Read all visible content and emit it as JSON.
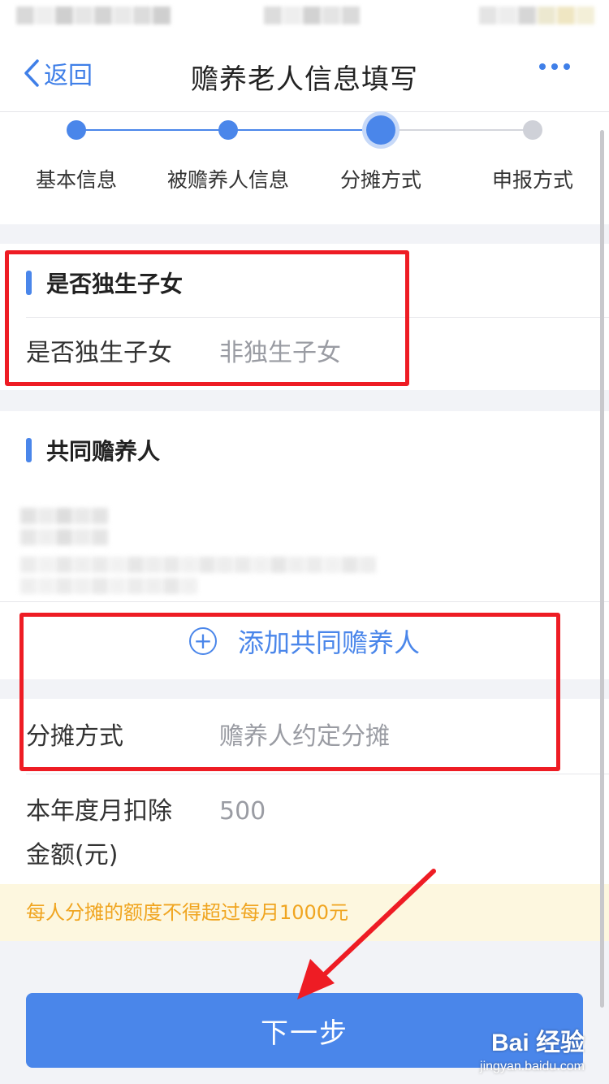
{
  "nav": {
    "back_label": "返回",
    "title": "赡养老人信息填写"
  },
  "steps": [
    {
      "label": "基本信息",
      "state": "done"
    },
    {
      "label": "被赡养人信息",
      "state": "done"
    },
    {
      "label": "分摊方式",
      "state": "current"
    },
    {
      "label": "申报方式",
      "state": "todo"
    }
  ],
  "only_child": {
    "section_title": "是否独生子女",
    "field_label": "是否独生子女",
    "field_value": "非独生子女"
  },
  "co_supporters": {
    "section_title": "共同赡养人",
    "add_label": "添加共同赡养人"
  },
  "allocation": {
    "method_label": "分摊方式",
    "method_value": "赡养人约定分摊",
    "monthly_label_line1": "本年度月扣除",
    "monthly_label_line2": "金额(元)",
    "monthly_value": "500"
  },
  "tip": "每人分摊的额度不得超过每月1000元",
  "next_label": "下一步",
  "watermark": {
    "brand": "Bai 经验",
    "url": "jingyan.baidu.com"
  },
  "colors": {
    "accent": "#4a86ea",
    "highlight_box": "#ee1c24",
    "tip_text": "#f0a520",
    "tip_bg": "#fdf7df"
  }
}
